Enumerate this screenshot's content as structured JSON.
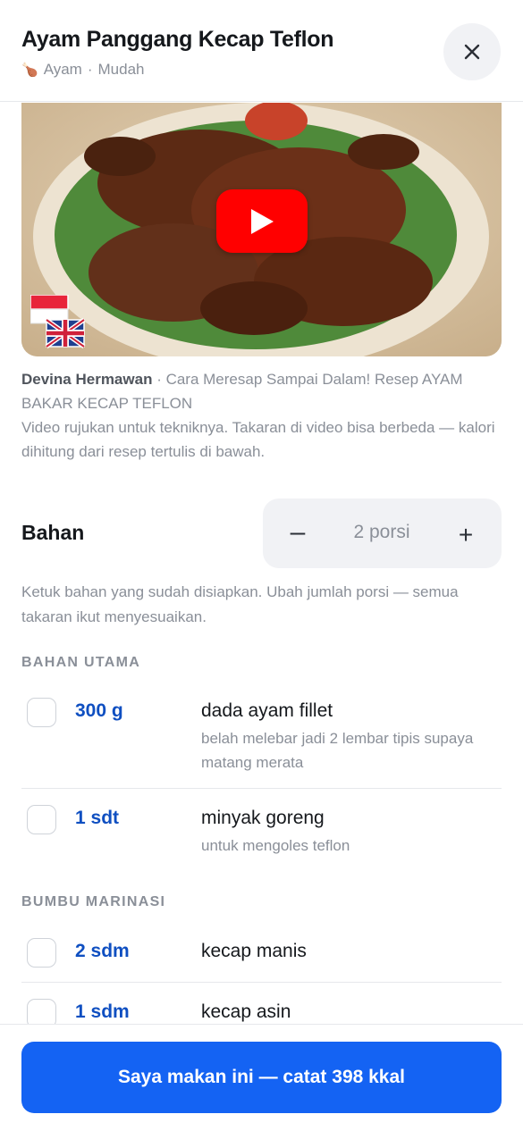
{
  "header": {
    "title": "Ayam Panggang Kecap Teflon",
    "category": "Ayam",
    "separator": "·",
    "difficulty": "Mudah",
    "category_icon": "drumstick-icon"
  },
  "video": {
    "channel": "Devina Hermawan",
    "title": "· Cara Meresap Sampai Dalam! Resep AYAM BAKAR KECAP TEFLON",
    "note": "Video rujukan untuk tekniknya. Takaran di video bisa berbeda — kalori dihitung dari resep tertulis di bawah.",
    "play_color": "#ff0000"
  },
  "ingredients": {
    "title": "Bahan",
    "servings": "2 porsi",
    "minus_label": "–",
    "plus_label": "+",
    "hint": "Ketuk bahan yang sudah disiapkan. Ubah jumlah porsi — semua takaran ikut menyesuaikan.",
    "groups": [
      {
        "title": "BAHAN UTAMA",
        "items": [
          {
            "qty": "300 g",
            "name": "dada ayam fillet",
            "note": "belah melebar jadi 2 lembar tipis supaya matang merata"
          },
          {
            "qty": "1 sdt",
            "name": "minyak goreng",
            "note": "untuk mengoles teflon"
          }
        ]
      },
      {
        "title": "BUMBU MARINASI",
        "items": [
          {
            "qty": "2 sdm",
            "name": "kecap manis",
            "note": ""
          },
          {
            "qty": "1 sdm",
            "name": "kecap asin",
            "note": ""
          }
        ]
      }
    ]
  },
  "footer": {
    "cta_label": "Saya makan ini — catat 398 kkal"
  },
  "colors": {
    "accent": "#1463f3",
    "qty": "#0f4fc1"
  }
}
